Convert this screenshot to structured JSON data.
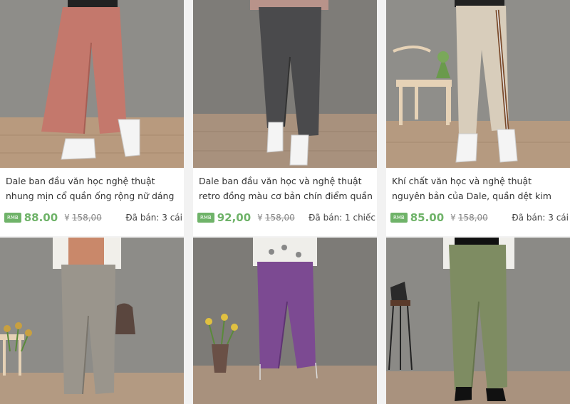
{
  "products": [
    {
      "title": "Dale ban đầu văn học nghệ thuật nhung mịn cổ quần ống rộng nữ dáng rộng tất",
      "badge": "RMB",
      "price": "88.00",
      "currency": "¥",
      "old_price": "158,00",
      "sold": "Đã bán: 3 cái"
    },
    {
      "title": "Dale ban đầu văn học và nghệ thuật retro đồng màu cơ bản chín điểm quần âu nữ",
      "badge": "RMB",
      "price": "92,00",
      "currency": "¥",
      "old_price": "158,00",
      "sold": "Đã bán: 1 chiếc"
    },
    {
      "title": "Khí chất văn học và nghệ thuật nguyên bản của Dale, quần dệt kim sọc bên rộng,",
      "badge": "RMB",
      "price": "85.00",
      "currency": "¥",
      "old_price": "158,00",
      "sold": "Đã bán: 3 cái"
    },
    {},
    {},
    {}
  ]
}
